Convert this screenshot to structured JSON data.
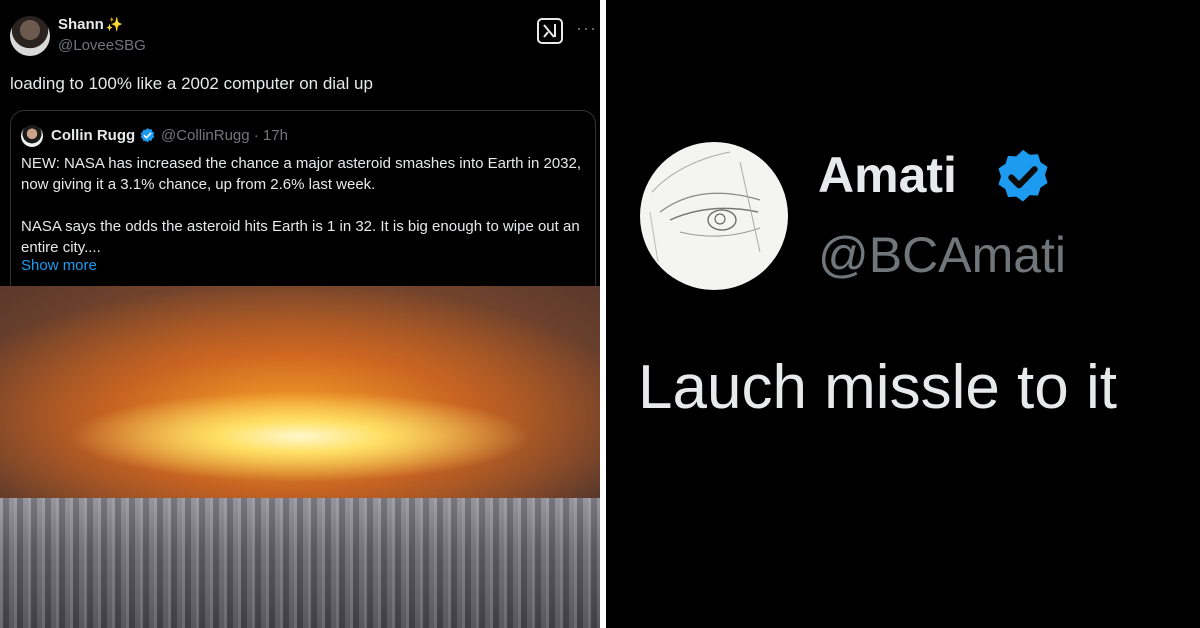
{
  "left_tweet": {
    "author_name": "Shann",
    "author_emoji": "✨",
    "author_handle": "@LoveeSBG",
    "more_label": "···",
    "text": "loading to 100% like a 2002 computer on dial up",
    "quote": {
      "author_name": "Collin Rugg",
      "author_handle": "@CollinRugg · 17h",
      "paragraph1": "NEW: NASA has increased the chance a major asteroid smashes into Earth in 2032, now giving it a 3.1% chance, up from 2.6% last week.",
      "paragraph2": "NASA says the odds the asteroid hits Earth is 1 in 32. It is big enough to wipe out an entire city....",
      "show_more": "Show more"
    }
  },
  "right_tweet": {
    "author_name": "Amati",
    "author_handle": "@BCAmati",
    "text": "Lauch missle to it"
  },
  "colors": {
    "background": "#000000",
    "primary_text": "#e7e9ea",
    "secondary_text": "#71767b",
    "link": "#1d9bf0",
    "verified": "#1d9bf0"
  },
  "icons": {
    "grok": "grok-icon",
    "verified": "verified-badge-icon",
    "more": "more-icon"
  }
}
